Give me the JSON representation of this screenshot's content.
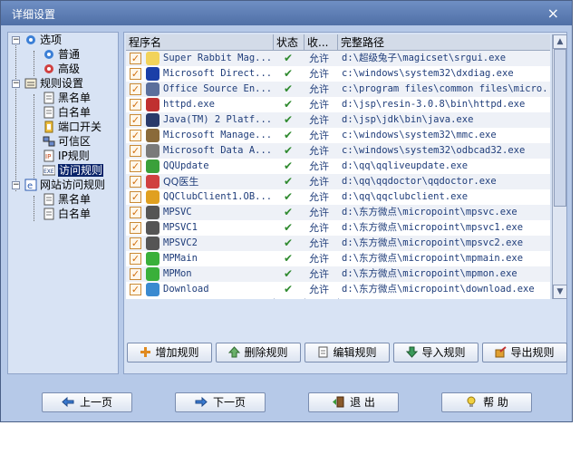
{
  "window": {
    "title": "详细设置",
    "close_label": "×"
  },
  "tree": [
    {
      "label": "选项",
      "icon": "gear-icon"
    },
    {
      "label": "普通",
      "icon": "gear-icon"
    },
    {
      "label": "高级",
      "icon": "gear-icon"
    },
    {
      "label": "规则设置",
      "icon": "rules-icon"
    },
    {
      "label": "黑名单",
      "icon": "document-icon"
    },
    {
      "label": "白名单",
      "icon": "document-icon"
    },
    {
      "label": "端口开关",
      "icon": "port-icon"
    },
    {
      "label": "可信区",
      "icon": "network-icon"
    },
    {
      "label": "IP规则",
      "icon": "ip-icon"
    },
    {
      "label": "访问规则",
      "icon": "exe-icon",
      "selected": true
    },
    {
      "label": "网站访问规则",
      "icon": "web-icon"
    },
    {
      "label": "黑名单",
      "icon": "document-icon"
    },
    {
      "label": "白名单",
      "icon": "document-icon"
    }
  ],
  "table": {
    "columns": [
      "程序名",
      "状态",
      "收...",
      "完整路径"
    ],
    "rows": [
      {
        "name": "Super Rabbit Mag...",
        "status": "✔",
        "recv": "允许",
        "path": "d:\\超级兔子\\magicset\\srgui.exe",
        "icon_color": "#f2d35a"
      },
      {
        "name": "Microsoft Direct...",
        "status": "✔",
        "recv": "允许",
        "path": "c:\\windows\\system32\\dxdiag.exe",
        "icon_color": "#1b3fa8"
      },
      {
        "name": "Office Source En...",
        "status": "✔",
        "recv": "允许",
        "path": "c:\\program files\\common files\\micro...",
        "icon_color": "#5b6f9c"
      },
      {
        "name": "httpd.exe",
        "status": "✔",
        "recv": "允许",
        "path": "d:\\jsp\\resin-3.0.8\\bin\\httpd.exe",
        "icon_color": "#c03030"
      },
      {
        "name": "Java(TM) 2 Platf...",
        "status": "✔",
        "recv": "允许",
        "path": "d:\\jsp\\jdk\\bin\\java.exe",
        "icon_color": "#2a3a6a"
      },
      {
        "name": "Microsoft Manage...",
        "status": "✔",
        "recv": "允许",
        "path": "c:\\windows\\system32\\mmc.exe",
        "icon_color": "#8a6a3a"
      },
      {
        "name": "Microsoft Data A...",
        "status": "✔",
        "recv": "允许",
        "path": "c:\\windows\\system32\\odbcad32.exe",
        "icon_color": "#7a7a7a"
      },
      {
        "name": "QQUpdate",
        "status": "✔",
        "recv": "允许",
        "path": "d:\\qq\\qqliveupdate.exe",
        "icon_color": "#3aa03a"
      },
      {
        "name": "QQ医生",
        "status": "✔",
        "recv": "允许",
        "path": "d:\\qq\\qqdoctor\\qqdoctor.exe",
        "icon_color": "#d04040"
      },
      {
        "name": "QQClubClient1.OB...",
        "status": "✔",
        "recv": "允许",
        "path": "d:\\qq\\qqclubclient.exe",
        "icon_color": "#e0a020"
      },
      {
        "name": "MPSVC",
        "status": "✔",
        "recv": "允许",
        "path": "d:\\东方微点\\micropoint\\mpsvc.exe",
        "icon_color": "#555555"
      },
      {
        "name": "MPSVC1",
        "status": "✔",
        "recv": "允许",
        "path": "d:\\东方微点\\micropoint\\mpsvc1.exe",
        "icon_color": "#555555"
      },
      {
        "name": "MPSVC2",
        "status": "✔",
        "recv": "允许",
        "path": "d:\\东方微点\\micropoint\\mpsvc2.exe",
        "icon_color": "#555555"
      },
      {
        "name": "MPMain",
        "status": "✔",
        "recv": "允许",
        "path": "d:\\东方微点\\micropoint\\mpmain.exe",
        "icon_color": "#3ab03a"
      },
      {
        "name": "MPMon",
        "status": "✔",
        "recv": "允许",
        "path": "d:\\东方微点\\micropoint\\mpmon.exe",
        "icon_color": "#3ab03a"
      },
      {
        "name": "Download",
        "status": "✔",
        "recv": "允许",
        "path": "d:\\东方微点\\micropoint\\download.exe",
        "icon_color": "#3a8ad0"
      }
    ]
  },
  "actions": {
    "add": "增加规则",
    "delete": "删除规则",
    "edit": "编辑规则",
    "import": "导入规则",
    "export": "导出规则"
  },
  "nav": {
    "prev": "上一页",
    "next": "下一页",
    "exit": "退 出",
    "help": "帮 助"
  },
  "colors": {
    "window_bg": "#b6c9e8",
    "title_bar": "#5a79b0",
    "selected_bg": "#0a246a",
    "check_green": "#2f8a2f"
  }
}
